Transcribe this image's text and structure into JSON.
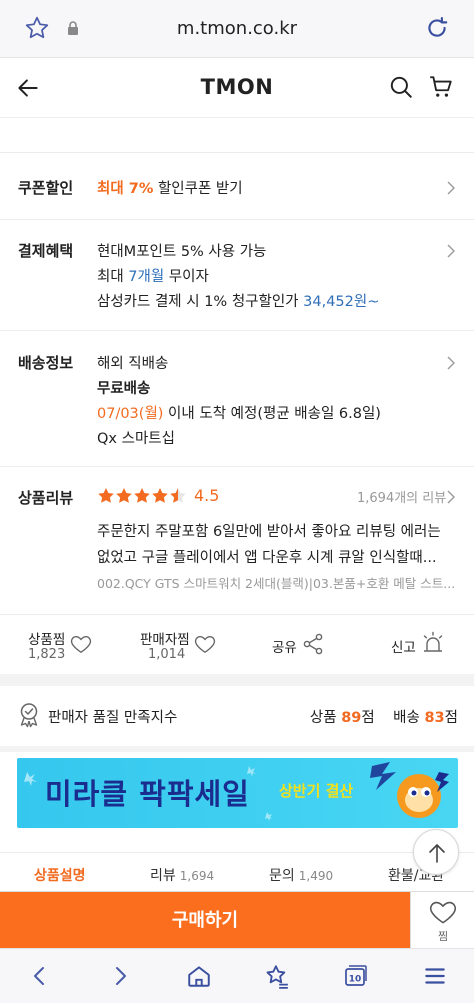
{
  "browser": {
    "url": "m.tmon.co.kr",
    "tab_count": "10"
  },
  "header": {
    "logo": "TMON"
  },
  "coupon": {
    "label": "쿠폰할인",
    "highlight": "최대 7%",
    "text": " 할인쿠폰 받기"
  },
  "payment": {
    "label": "결제혜택",
    "line1": "현대M포인트 5% 사용 가능",
    "line2_prefix": "최대 ",
    "line2_highlight": "7개월",
    "line2_suffix": " 무이자",
    "line3_prefix": "삼성카드 결제 시 1% 청구할인가 ",
    "line3_highlight": "34,452원~"
  },
  "shipping": {
    "label": "배송정보",
    "type": "해외 직배송",
    "fee": "무료배송",
    "date": "07/03(월)",
    "date_suffix": " 이내 도착 예정(평균 배송일 6.8일)",
    "carrier": "Qx 스마트십"
  },
  "review": {
    "label": "상품리뷰",
    "rating": "4.5",
    "rating_value": 4.5,
    "count": "1,694개의 리뷰",
    "text_line1": "주문한지 주말포함 6일만에 받아서 좋아요 리뷰팅 에러는",
    "text_line2": "없었고 구글 플레이에서 앱 다운후 시계 큐알 인식할때...",
    "option": "002.QCY GTS 스마트워치 2세대(블랙)|03.본품+호환 메탈 스트..."
  },
  "actions": {
    "wishlist_label": "상품찜",
    "wishlist_count": "1,823",
    "seller_wish_label": "판매자찜",
    "seller_wish_count": "1,014",
    "share_label": "공유",
    "report_label": "신고"
  },
  "quality": {
    "title": "판매자 품질 만족지수",
    "product_label": "상품 ",
    "product_score": "89",
    "product_unit": "점",
    "shipping_label": "배송 ",
    "shipping_score": "83",
    "shipping_unit": "점"
  },
  "banner": {
    "main": "미라클 팍팍세일",
    "sub": "상반기 결산"
  },
  "tabs": [
    {
      "label": "상품설명",
      "count": ""
    },
    {
      "label": "리뷰",
      "count": "1,694"
    },
    {
      "label": "문의",
      "count": "1,490"
    },
    {
      "label": "환불/교환",
      "count": ""
    }
  ],
  "buybar": {
    "buy_label": "구매하기",
    "wish_label": "찜"
  },
  "colors": {
    "accent": "#f26b21",
    "buy": "#fa6e1e",
    "link": "#2f6fb9"
  }
}
